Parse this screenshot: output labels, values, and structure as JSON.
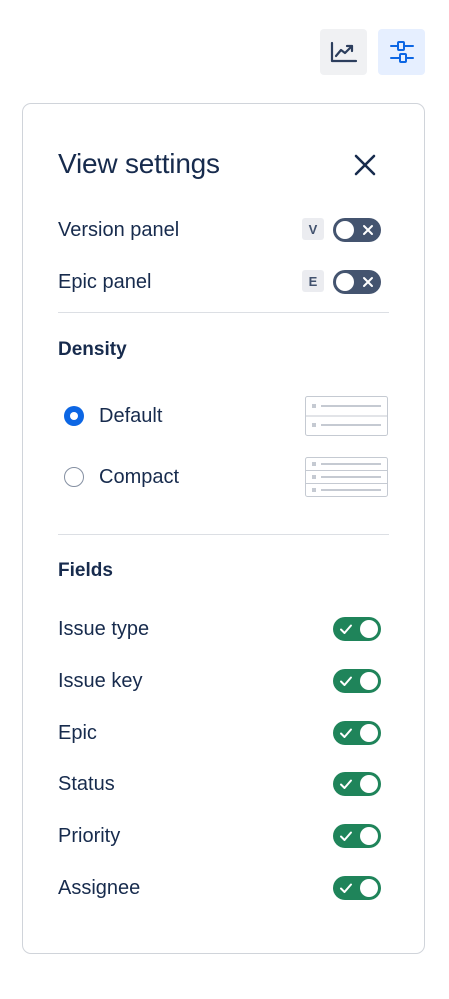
{
  "toolbar": {
    "insights_icon": "trending-chart-icon",
    "settings_icon": "sliders-icon"
  },
  "panel": {
    "title": "View settings",
    "close_icon": "close-icon",
    "panels": [
      {
        "label": "Version panel",
        "shortcut": "V",
        "enabled": false
      },
      {
        "label": "Epic panel",
        "shortcut": "E",
        "enabled": false
      }
    ],
    "density": {
      "heading": "Density",
      "options": [
        {
          "label": "Default",
          "selected": true
        },
        {
          "label": "Compact",
          "selected": false
        }
      ]
    },
    "fields": {
      "heading": "Fields",
      "items": [
        {
          "label": "Issue type",
          "enabled": true
        },
        {
          "label": "Issue key",
          "enabled": true
        },
        {
          "label": "Epic",
          "enabled": true
        },
        {
          "label": "Status",
          "enabled": true
        },
        {
          "label": "Priority",
          "enabled": true
        },
        {
          "label": "Assignee",
          "enabled": true
        }
      ]
    }
  },
  "colors": {
    "accent": "#0c66e4",
    "toggle_on": "#1f845a",
    "toggle_off": "#44546f",
    "text": "#172b4d"
  }
}
